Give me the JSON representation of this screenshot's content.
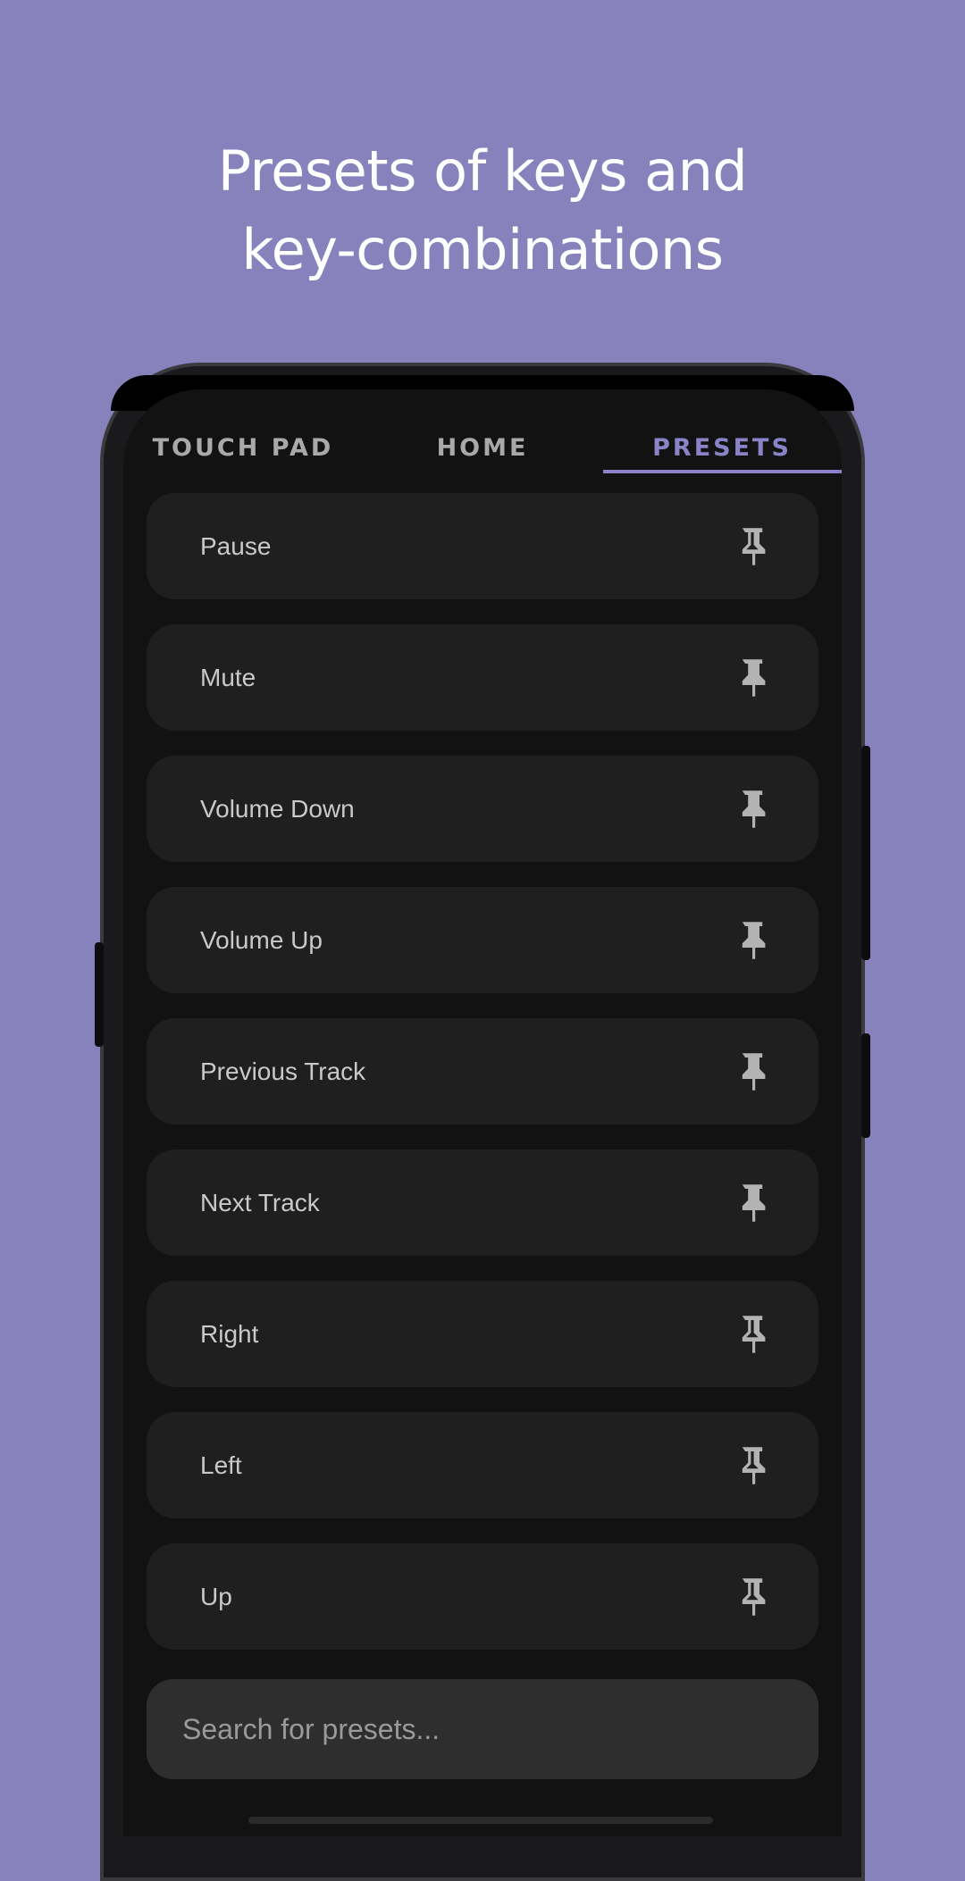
{
  "promo": {
    "title_line1": "Presets of keys and",
    "title_line2": "key-combinations"
  },
  "tabs": [
    {
      "label": "TOUCH PAD",
      "active": false
    },
    {
      "label": "HOME",
      "active": false
    },
    {
      "label": "PRESETS",
      "active": true
    }
  ],
  "presets": [
    {
      "label": "Pause",
      "pinned": false
    },
    {
      "label": "Mute",
      "pinned": true
    },
    {
      "label": "Volume Down",
      "pinned": true
    },
    {
      "label": "Volume Up",
      "pinned": true
    },
    {
      "label": "Previous Track",
      "pinned": true
    },
    {
      "label": "Next Track",
      "pinned": true
    },
    {
      "label": "Right",
      "pinned": false
    },
    {
      "label": "Left",
      "pinned": false
    },
    {
      "label": "Up",
      "pinned": false
    }
  ],
  "search": {
    "placeholder": "Search for presets...",
    "value": ""
  },
  "colors": {
    "background": "#8782bc",
    "accent": "#8a83c8",
    "surface": "#1f1f1f",
    "screen": "#121212"
  },
  "icons": {
    "pin_filled": "pin-filled-icon",
    "pin_outline": "pin-outline-icon"
  }
}
